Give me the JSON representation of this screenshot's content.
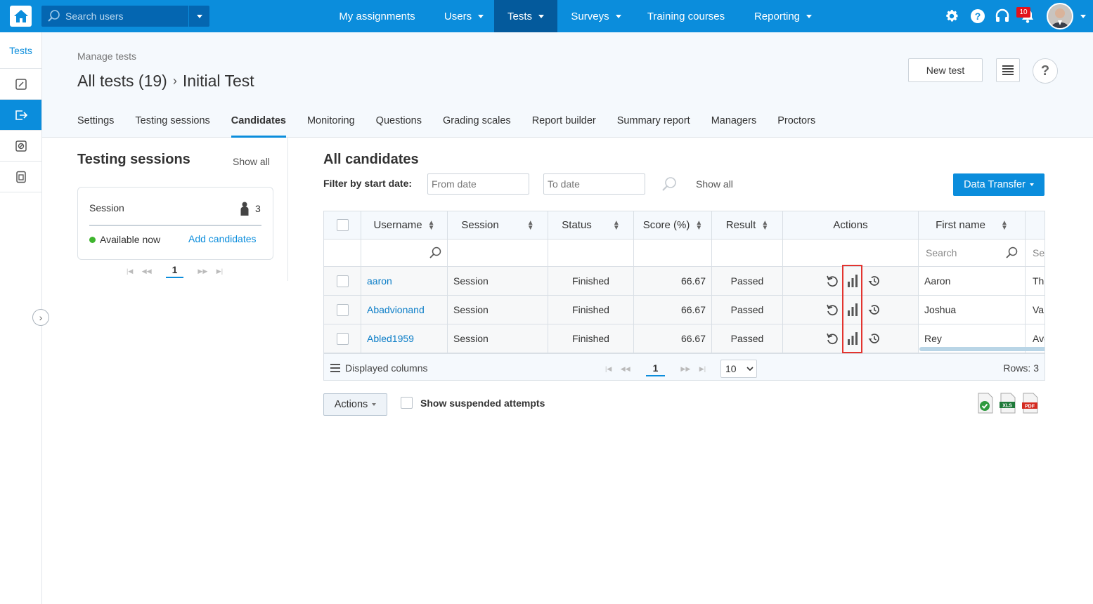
{
  "topbar": {
    "search_placeholder": "Search users",
    "nav": [
      "My assignments",
      "Users",
      "Tests",
      "Surveys",
      "Training courses",
      "Reporting"
    ],
    "notifications_count": "10",
    "accent": "#0b8ddc",
    "active_nav_color": "#045a9c"
  },
  "leftrail": {
    "title": "Tests",
    "icons": [
      "edit-icon",
      "export-icon",
      "cancel-icon",
      "document-icon"
    ]
  },
  "header": {
    "breadcrumb_small": "Manage tests",
    "title_main": "All tests (19)",
    "title_sep": "›",
    "title_current": "Initial Test",
    "new_test_label": "New test",
    "help_label": "?"
  },
  "tabs": [
    "Settings",
    "Testing sessions",
    "Candidates",
    "Monitoring",
    "Questions",
    "Grading scales",
    "Report builder",
    "Summary report",
    "Managers",
    "Proctors"
  ],
  "sessions_panel": {
    "title": "Testing sessions",
    "show_all": "Show all",
    "card": {
      "name": "Session",
      "count": "3",
      "status": "Available now",
      "add_label": "Add candidates"
    },
    "page": "1"
  },
  "candidates": {
    "title": "All candidates",
    "filter_label": "Filter by start date:",
    "from_placeholder": "From date",
    "to_placeholder": "To date",
    "show_all": "Show all",
    "data_transfer_label": "Data Transfer",
    "columns": [
      "Username",
      "Session",
      "Status",
      "Score (%)",
      "Result",
      "Actions",
      "First name"
    ],
    "first_name_search_placeholder": "Search",
    "partial_filter_placeholder": "Se",
    "rows": [
      {
        "username": "aaron",
        "session": "Session",
        "status": "Finished",
        "score": "66.67",
        "result": "Passed",
        "first_name": "Aaron",
        "last_name_partial": "Tho"
      },
      {
        "username": "Abadvionand",
        "session": "Session",
        "status": "Finished",
        "score": "66.67",
        "result": "Passed",
        "first_name": "Joshua",
        "last_name_partial": "Val"
      },
      {
        "username": "Abled1959",
        "session": "Session",
        "status": "Finished",
        "score": "66.67",
        "result": "Passed",
        "first_name": "Rey",
        "last_name_partial": "Ave"
      }
    ],
    "footer": {
      "displayed_columns": "Displayed columns",
      "page": "1",
      "page_size": "10",
      "rows_label": "Rows: 3"
    },
    "actions_label": "Actions",
    "suspended_label": "Show suspended attempts",
    "export_icons": [
      "csv-export-icon",
      "xls-export-icon",
      "pdf-export-icon"
    ],
    "xls_text": "XLS",
    "pdf_text": "PDF",
    "passed_color": "#3fb52e",
    "highlight_color": "#e3342f"
  }
}
